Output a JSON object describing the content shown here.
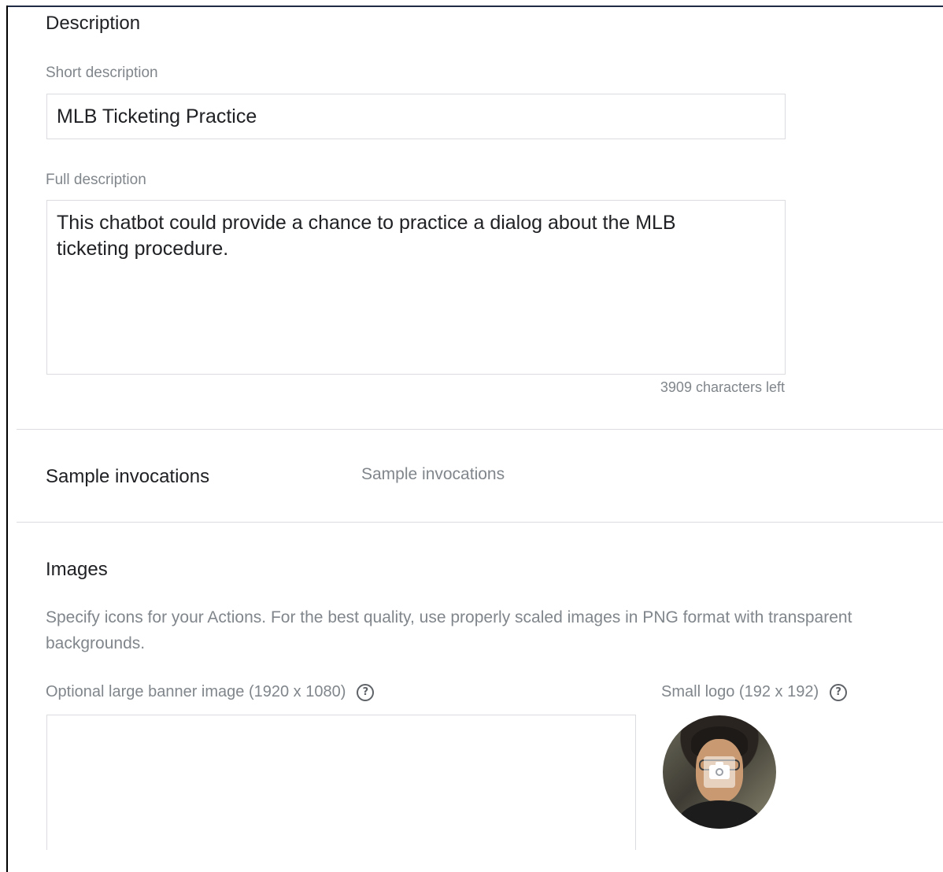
{
  "description_section": {
    "title": "Description",
    "short_description_label": "Short description",
    "short_description_value": "MLB Ticketing Practice",
    "full_description_label": "Full description",
    "full_description_value": "This chatbot could provide a chance to practice a dialog about the MLB\nticketing procedure.",
    "characters_left": "3909 characters left"
  },
  "sample_invocations": {
    "title": "Sample invocations",
    "placeholder": "Sample invocations"
  },
  "images_section": {
    "title": "Images",
    "description": "Specify icons for your Actions. For the best quality, use properly scaled images in PNG format with transparent backgrounds.",
    "banner_label": "Optional large banner image (1920 x 1080)",
    "logo_label": "Small logo (192 x 192)",
    "help_icon": "help-circle-icon",
    "camera_icon": "camera-icon"
  }
}
